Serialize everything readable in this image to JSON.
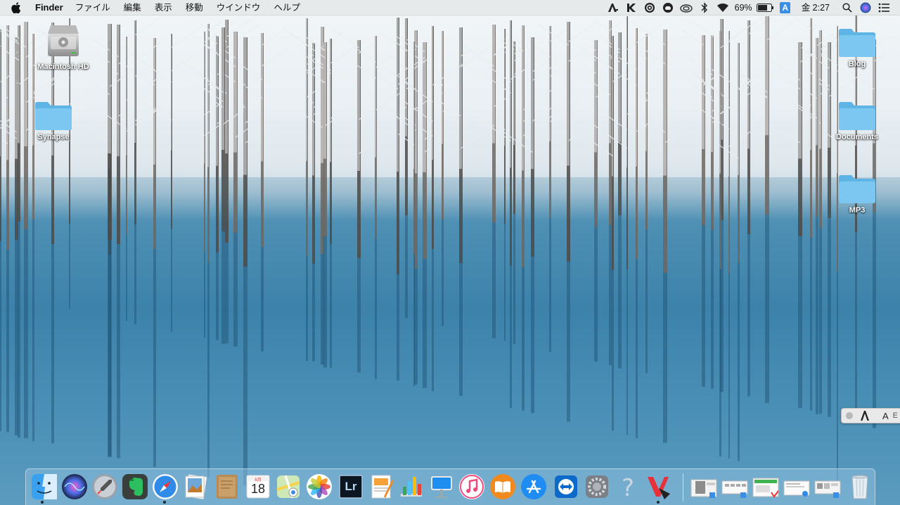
{
  "menubar": {
    "apple_icon": "apple-icon",
    "app_name": "Finder",
    "menus": [
      "ファイル",
      "編集",
      "表示",
      "移動",
      "ウインドウ",
      "ヘルプ"
    ],
    "battery_percent": "69%",
    "input_source": "A",
    "clock": "金 2:27"
  },
  "desktop": {
    "icons": [
      {
        "label": "Macintosh HD",
        "kind": "hard-drive-icon"
      },
      {
        "label": "Synapse",
        "kind": "folder-icon"
      },
      {
        "label": "Blog",
        "kind": "folder-icon"
      },
      {
        "label": "Documents",
        "kind": "folder-icon"
      },
      {
        "label": "MP3",
        "kind": "folder-icon"
      }
    ]
  },
  "float_toolbar": {
    "letter": "A",
    "letter2": "E"
  },
  "dock": {
    "apps": [
      {
        "name": "finder-icon",
        "running": true
      },
      {
        "name": "siri-icon",
        "running": false
      },
      {
        "name": "launchpad-icon",
        "running": false
      },
      {
        "name": "evernote-icon",
        "running": false
      },
      {
        "name": "safari-icon",
        "running": true
      },
      {
        "name": "preview-icon",
        "running": false
      },
      {
        "name": "notefile-icon",
        "running": false
      },
      {
        "name": "calendar-icon",
        "running": false
      },
      {
        "name": "maps-icon",
        "running": false
      },
      {
        "name": "photos-icon",
        "running": false
      },
      {
        "name": "lightroom-icon",
        "running": false
      },
      {
        "name": "pages-icon",
        "running": false
      },
      {
        "name": "numbers-icon",
        "running": false
      },
      {
        "name": "keynote-icon",
        "running": false
      },
      {
        "name": "itunes-icon",
        "running": false
      },
      {
        "name": "ibooks-icon",
        "running": false
      },
      {
        "name": "app-store-icon",
        "running": false
      },
      {
        "name": "teamviewer-icon",
        "running": false
      },
      {
        "name": "system-preferences-icon",
        "running": false
      },
      {
        "name": "help-icon",
        "running": false
      },
      {
        "name": "vivaldi-icon",
        "running": true
      }
    ],
    "calendar": {
      "month": "6月",
      "day": "18"
    },
    "lightroom_label": "Lr",
    "help_label": "?",
    "minimized_windows": 5,
    "colors": {
      "finder": "#3aa0f0",
      "safari": "#2f8ae8",
      "evernote": "#2dbe60",
      "itunes": "#f04a7c",
      "ibooks": "#f08a1e",
      "app_store": "#1e8cf0"
    }
  }
}
